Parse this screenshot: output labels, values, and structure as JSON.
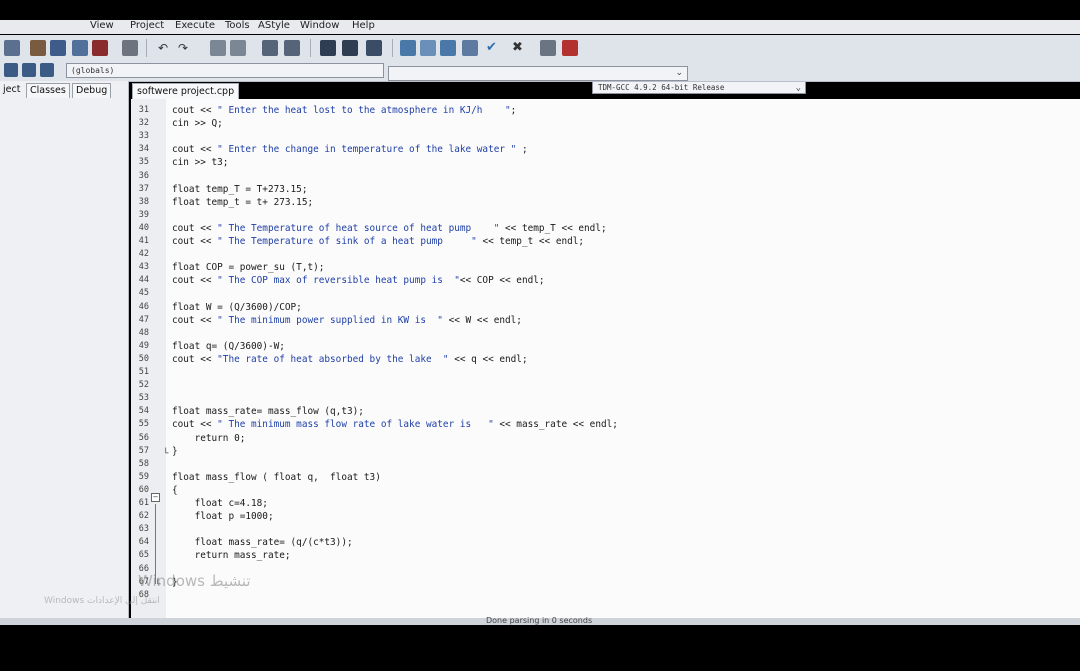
{
  "menu": [
    "View",
    "Project",
    "Execute",
    "Tools",
    "AStyle",
    "Window",
    "Help"
  ],
  "toolbar": {
    "compiler": "TDM-GCC 4.9.2 64-bit Release",
    "scope": "(globals)",
    "function": ""
  },
  "project_panel": {
    "tabs": [
      "ject",
      "Classes",
      "Debug"
    ]
  },
  "editor": {
    "file_tab": "softwere project.cpp",
    "lines": [
      {
        "n": "31",
        "code": "cout << \" Enter the heat lost to the atmosphere in KJ/h    \";"
      },
      {
        "n": "32",
        "code": "cin >> Q;"
      },
      {
        "n": "33",
        "code": ""
      },
      {
        "n": "34",
        "code": "cout << \" Enter the change in temperature of the lake water \" ;"
      },
      {
        "n": "35",
        "code": "cin >> t3;"
      },
      {
        "n": "36",
        "code": ""
      },
      {
        "n": "37",
        "code": "float temp_T = T+273.15;"
      },
      {
        "n": "38",
        "code": "float temp_t = t+ 273.15;"
      },
      {
        "n": "39",
        "code": ""
      },
      {
        "n": "40",
        "code": "cout << \" The Temperature of heat source of heat pump    \" << temp_T << endl;"
      },
      {
        "n": "41",
        "code": "cout << \" The Temperature of sink of a heat pump     \" << temp_t << endl;"
      },
      {
        "n": "42",
        "code": ""
      },
      {
        "n": "43",
        "code": "float COP = power_su (T,t);"
      },
      {
        "n": "44",
        "code": "cout << \" The COP max of reversible heat pump is  \"<< COP << endl;"
      },
      {
        "n": "45",
        "code": ""
      },
      {
        "n": "46",
        "code": "float W = (Q/3600)/COP;"
      },
      {
        "n": "47",
        "code": "cout << \" The minimum power supplied in KW is  \" << W << endl;"
      },
      {
        "n": "48",
        "code": ""
      },
      {
        "n": "49",
        "code": "float q= (Q/3600)-W;"
      },
      {
        "n": "50",
        "code": "cout << \"The rate of heat absorbed by the lake  \" << q << endl;"
      },
      {
        "n": "51",
        "code": ""
      },
      {
        "n": "52",
        "code": ""
      },
      {
        "n": "53",
        "code": ""
      },
      {
        "n": "54",
        "code": "float mass_rate= mass_flow (q,t3);"
      },
      {
        "n": "55",
        "code": "cout << \" The minimum mass flow rate of lake water is   \" << mass_rate << endl;"
      },
      {
        "n": "56",
        "code": "    return 0;"
      },
      {
        "n": "57",
        "code": "}"
      },
      {
        "n": "58",
        "code": ""
      },
      {
        "n": "59",
        "code": "float mass_flow ( float q,  float t3)"
      },
      {
        "n": "60",
        "code": "{"
      },
      {
        "n": "61",
        "code": "    float c=4.18;"
      },
      {
        "n": "62",
        "code": "    float p =1000;"
      },
      {
        "n": "63",
        "code": ""
      },
      {
        "n": "64",
        "code": "    float mass_rate= (q/(c*t3));"
      },
      {
        "n": "65",
        "code": "    return mass_rate;"
      },
      {
        "n": "66",
        "code": ""
      },
      {
        "n": "67",
        "code": "}"
      },
      {
        "n": "68",
        "code": ""
      }
    ]
  },
  "watermark": {
    "line1": "Windows تنشيط",
    "line2": "Windows انتقل إلى الإعدادات"
  },
  "status": "Done parsing in 0 seconds",
  "colors": {
    "string": "#1f3fa6",
    "editor_bg": "#fbfbfc",
    "gutter_bg": "#eceef1",
    "panel_bg": "#eef0f4"
  }
}
